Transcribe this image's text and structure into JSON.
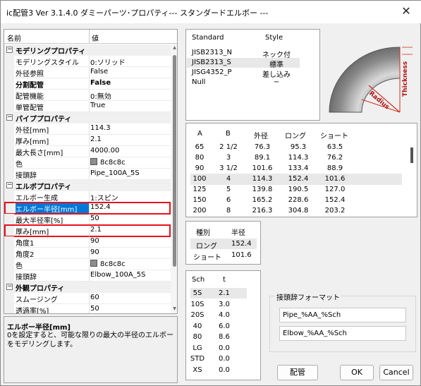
{
  "window": {
    "title": "ic配管3 Ver 3.1.4.0 ダミーパーツ･プロパティ--- スタンダードエルボー ---",
    "close_glyph": "✕"
  },
  "property_grid": {
    "header_name": "名前",
    "header_value": "値",
    "rows": [
      {
        "type": "category",
        "label": "モデリングプロパティ",
        "toggle": "−"
      },
      {
        "type": "prop",
        "name": "モデリングスタイル",
        "value": "0:ソリッド"
      },
      {
        "type": "prop",
        "name": "外径参照",
        "value": "False"
      },
      {
        "type": "prop",
        "name": "分割配管",
        "value": "False"
      },
      {
        "type": "prop",
        "name": "配管機能",
        "value": "0:無効"
      },
      {
        "type": "prop",
        "name": "単管配管",
        "value": "True"
      },
      {
        "type": "category",
        "label": "パイププロパティ",
        "toggle": "−"
      },
      {
        "type": "prop",
        "name": "外径[mm]",
        "value": "114.3"
      },
      {
        "type": "prop",
        "name": "厚み[mm]",
        "value": "2.1"
      },
      {
        "type": "prop",
        "name": "最大長さ[mm]",
        "value": "4000.00"
      },
      {
        "type": "prop",
        "name": "色",
        "value": "8c8c8c",
        "swatch": "#8c8c8c"
      },
      {
        "type": "prop",
        "name": "接頭辞",
        "value": "Pipe_100A_5S"
      },
      {
        "type": "category",
        "label": "エルボプロパティ",
        "toggle": "−"
      },
      {
        "type": "prop",
        "name": "エルボー生成",
        "value": "1:スピン"
      },
      {
        "type": "prop",
        "name": "エルボー半径[mm]",
        "value": "152.4",
        "selected": true,
        "highlight": true
      },
      {
        "type": "prop",
        "name": "最大半径率[%]",
        "value": "50"
      },
      {
        "type": "prop",
        "name": "厚み[mm]",
        "value": "2.1",
        "highlight": true
      },
      {
        "type": "prop",
        "name": "角度1",
        "value": "90"
      },
      {
        "type": "prop",
        "name": "角度2",
        "value": "90"
      },
      {
        "type": "prop",
        "name": "色",
        "value": "8c8c8c",
        "swatch": "#8c8c8c"
      },
      {
        "type": "prop",
        "name": "接頭辞",
        "value": "Elbow_100A_5S"
      },
      {
        "type": "category",
        "label": "外観プロパティ",
        "toggle": "−"
      },
      {
        "type": "prop",
        "name": "スムージング",
        "value": "60"
      },
      {
        "type": "prop",
        "name": "透過率[%]",
        "value": "50"
      }
    ]
  },
  "description": {
    "title": "エルボー半径[mm]",
    "body": "0を設定すると、可能な限りの最大の半径のエルボーをモデリングします。"
  },
  "standards": {
    "header_standard": "Standard",
    "header_style": "Style",
    "rows": [
      {
        "standard": "JISB2313_N",
        "style": "ネック付"
      },
      {
        "standard": "JISB2313_S",
        "style": "標準",
        "selected": true
      },
      {
        "standard": "JISG4352_P",
        "style": "差し込み"
      },
      {
        "standard": "Null",
        "style": "−"
      }
    ]
  },
  "elbow_image": {
    "radius_label": "Radius",
    "thickness_label": "Thickness"
  },
  "size_table": {
    "headers": [
      "A",
      "B",
      "外径",
      "ロング",
      "ショート"
    ],
    "rows": [
      [
        "65",
        "2 1/2",
        "76.3",
        "95.3",
        "63.5"
      ],
      [
        "80",
        "3",
        "89.1",
        "114.3",
        "76.2"
      ],
      [
        "90",
        "3 1/2",
        "101.6",
        "133.4",
        "88.9"
      ],
      [
        "100",
        "4",
        "114.3",
        "152.4",
        "101.6"
      ],
      [
        "125",
        "5",
        "139.8",
        "190.5",
        "127.0"
      ],
      [
        "150",
        "6",
        "165.2",
        "228.6",
        "152.4"
      ],
      [
        "200",
        "8",
        "216.3",
        "304.8",
        "203.2"
      ]
    ],
    "selected_row": 3
  },
  "radius_table": {
    "header_kind": "種別",
    "header_radius": "半径",
    "rows": [
      {
        "kind": "ロング",
        "radius": "152.4"
      },
      {
        "kind": "ショート",
        "radius": "101.6"
      }
    ]
  },
  "sch_table": {
    "header_sch": "Sch",
    "header_t": "t",
    "rows": [
      {
        "sch": "5S",
        "t": "2.1"
      },
      {
        "sch": "10S",
        "t": "3.0"
      },
      {
        "sch": "20S",
        "t": "4.0"
      },
      {
        "sch": "40",
        "t": "6.0"
      },
      {
        "sch": "80",
        "t": "8.6"
      },
      {
        "sch": "LG",
        "t": "0.0"
      },
      {
        "sch": "STD",
        "t": "0.0"
      },
      {
        "sch": "XS",
        "t": "0.0"
      }
    ]
  },
  "prefix_format": {
    "label": "接頭辞フォーマット",
    "pipe_format": "Pipe_%AA_%Sch",
    "elbow_format": "Elbow_%AA_%Sch"
  },
  "buttons": {
    "piping": "配管",
    "ok": "OK",
    "cancel": "Cancel"
  }
}
